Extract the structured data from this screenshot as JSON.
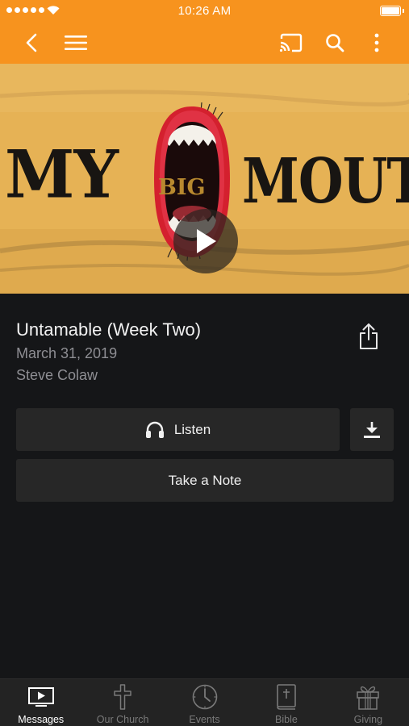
{
  "status_bar": {
    "time": "10:26 AM"
  },
  "nav": {
    "icons": [
      "back-chevron-icon",
      "menu-icon",
      "cast-icon",
      "search-icon",
      "more-vertical-icon"
    ],
    "accent_color": "#f7931e"
  },
  "hero": {
    "artwork_words": [
      "MY",
      "BIG",
      "MOUTH"
    ],
    "background_color": "#e7b356"
  },
  "message": {
    "title": "Untamable (Week Two)",
    "date": "March 31, 2019",
    "speaker": "Steve Colaw"
  },
  "actions": {
    "listen_label": "Listen",
    "note_label": "Take a Note"
  },
  "tabs": [
    {
      "label": "Messages",
      "icon": "video-icon",
      "active": true
    },
    {
      "label": "Our Church",
      "icon": "cross-icon",
      "active": false
    },
    {
      "label": "Events",
      "icon": "clock-icon",
      "active": false
    },
    {
      "label": "Bible",
      "icon": "bible-icon",
      "active": false
    },
    {
      "label": "Giving",
      "icon": "gift-icon",
      "active": false
    }
  ]
}
